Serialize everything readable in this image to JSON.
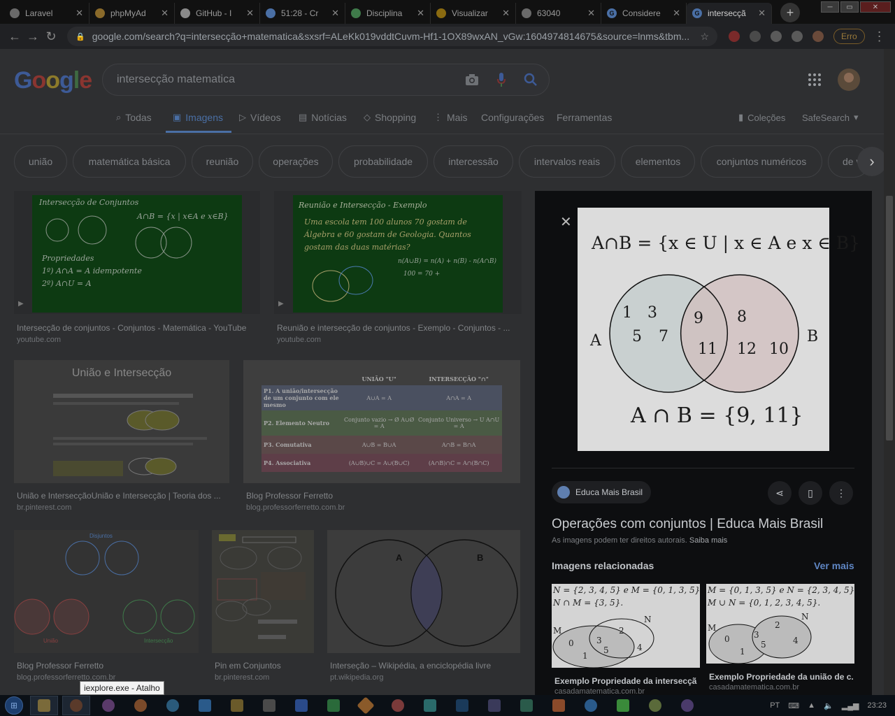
{
  "browser": {
    "tabs": [
      {
        "label": "Laravel",
        "icon": "globe-icon",
        "color": "#6a6a6a"
      },
      {
        "label": "phpMyAd",
        "icon": "phpmyadmin-icon",
        "color": "#8a6a2a"
      },
      {
        "label": "GitHub - I",
        "icon": "github-icon",
        "color": "#8a8a8a"
      },
      {
        "label": "51:28 - Cr",
        "icon": "timer-icon",
        "color": "#4a6fa5"
      },
      {
        "label": "Disciplina",
        "icon": "moodle-icon",
        "color": "#3f7a4a"
      },
      {
        "label": "Visualizar",
        "icon": "doc-icon",
        "color": "#8a6a10"
      },
      {
        "label": "63040",
        "icon": "globe-icon",
        "color": "#6a6a6a"
      },
      {
        "label": "Considere",
        "icon": "google-icon",
        "color": "#4a6fa5"
      },
      {
        "label": "intersecçã",
        "icon": "google-icon",
        "color": "#4a6fa5"
      }
    ],
    "new_tab": "+",
    "url": "google.com/search?q=intersecção+matematica&sxsrf=ALeKk019vddtCuvm-Hf1-1OX89wxAN_vGw:1604974814675&source=lnms&tbm...",
    "error_button": "Erro"
  },
  "google": {
    "logo": [
      "G",
      "o",
      "o",
      "g",
      "l",
      "e"
    ],
    "query": "intersecção matematica",
    "tabs": [
      {
        "label": "Todas",
        "icon": "search-icon"
      },
      {
        "label": "Imagens",
        "icon": "image-icon"
      },
      {
        "label": "Vídeos",
        "icon": "video-icon"
      },
      {
        "label": "Notícias",
        "icon": "news-icon"
      },
      {
        "label": "Shopping",
        "icon": "tag-icon"
      },
      {
        "label": "Mais",
        "icon": "more-icon"
      }
    ],
    "tools": {
      "settings": "Configurações",
      "tools": "Ferramentas",
      "collections": "Coleções",
      "safesearch": "SafeSearch"
    },
    "chips": [
      "união",
      "matemática básica",
      "reunião",
      "operações",
      "probabilidade",
      "intercessão",
      "intervalos reais",
      "elementos",
      "conjuntos numéricos",
      "de v"
    ],
    "results": [
      {
        "title": "Intersecção de conjuntos - Conjuntos - Matemática - YouTube",
        "source": "youtube.com"
      },
      {
        "title": "Reunião e intersecção de conjuntos - Exemplo - Conjuntos - ...",
        "source": "youtube.com"
      },
      {
        "title": "União e IntersecçãoUnião e Intersecção | Teoria dos ...",
        "source": "br.pinterest.com"
      },
      {
        "title": "Blog Professor Ferretto",
        "source": "blog.professorferretto.com.br"
      },
      {
        "title": "Blog Professor Ferretto",
        "source": "blog.professorferretto.com.br"
      },
      {
        "title": "Pin em Conjuntos",
        "source": "br.pinterest.com"
      },
      {
        "title": "Interseção – Wikipédia, a enciclopédia livre",
        "source": "pt.wikipedia.org"
      }
    ],
    "thumb_texts": {
      "board1_title": "Intersecção de Conjuntos",
      "board1_formula": "A∩B = {x | x∈A e x∈B}",
      "board1_props": "Propriedades",
      "board1_p1": "1º) A∩A = A  idempotente",
      "board1_p2": "2º) A∩U = A",
      "board2_title": "Reunião e Intersecção - Exemplo",
      "board2_l1": "Uma escola tem 100 alunos 70 gostam de",
      "board2_l2": "Álgebra e 60 gostam de Geologia. Quantos",
      "board2_l3": "gostam das duas matérias?",
      "board2_l4": "n(A∪B) = n(A) + n(B) - n(A∩B)",
      "board2_l5": "100 = 70 +",
      "uniao_title": "União e Intersecção",
      "table_h1": "UNIÃO \"U\"",
      "table_h2": "INTERSECÇÃO \"∩\"",
      "table_rows": [
        {
          "label": "P1. A união/intersecção de um conjunto com ele mesmo",
          "u": "A∪A = A",
          "i": "A∩A = A"
        },
        {
          "label": "P2. Elemento Neutro",
          "u": "Conjunto vazio → Ø  A∪Ø = A",
          "i": "Conjunto Universo → U  A∩U = A"
        },
        {
          "label": "P3. Comutativa",
          "u": "A∪B = B∪A",
          "i": "A∩B = B∩A"
        },
        {
          "label": "P4. Associativa",
          "u": "(A∪B)∪C = A∪(B∪C)",
          "i": "(A∩B)∩C = A∩(B∩C)"
        }
      ],
      "disjuntos": "Disjuntos",
      "uniao": "União",
      "interseccao": "Intersecção",
      "wiki_a": "A",
      "wiki_b": "B"
    }
  },
  "panel": {
    "formula_top": "A∩B = {x ∈ U | x ∈ A e x ∈ B}",
    "set_a_label": "A",
    "set_b_label": "B",
    "a_only": [
      "1",
      "3",
      "5",
      "7"
    ],
    "both": [
      "9",
      "11"
    ],
    "b_only": [
      "8",
      "12",
      "10"
    ],
    "formula_bottom": "A ∩ B = {9, 11}",
    "source": "Educa Mais Brasil",
    "title": "Operações com conjuntos | Educa Mais Brasil",
    "copyright": "As imagens podem ter direitos autorais.",
    "learn_more": "Saiba mais",
    "related_heading": "Imagens relacionadas",
    "see_more": "Ver mais",
    "related": [
      {
        "l1": "N = {2, 3, 4, 5} e M = {0, 1, 3, 5}.",
        "l2": "N ∩ M = {3, 5}.",
        "caption": "Exemplo Propriedade da intersecçã...",
        "source": "casadamatematica.com.br"
      },
      {
        "l1": "M = {0, 1, 3, 5} e N = {2, 3, 4, 5}.",
        "l2": "M ∪ N = {0, 1, 2, 3, 4, 5}.",
        "caption": "Exemplo Propriedade da união de c...",
        "source": "casadamatematica.com.br"
      }
    ],
    "venn_labels": {
      "n": "N",
      "m": "M",
      "v0": "0",
      "v1": "1",
      "v2": "2",
      "v3": "3",
      "v4": "4",
      "v5": "5"
    }
  },
  "tooltip": "iexplore.exe - Atalho",
  "taskbar": {
    "lang": "PT",
    "time": "23:23"
  }
}
